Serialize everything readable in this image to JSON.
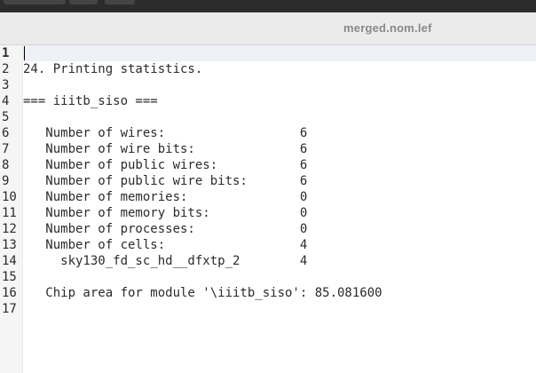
{
  "tab": {
    "title": "merged.nom.lef"
  },
  "editor": {
    "current_line": 1,
    "lines": [
      "",
      "24. Printing statistics.",
      "",
      "=== iiitb_siso ===",
      "",
      "   Number of wires:                  6",
      "   Number of wire bits:              6",
      "   Number of public wires:           6",
      "   Number of public wire bits:       6",
      "   Number of memories:               0",
      "   Number of memory bits:            0",
      "   Number of processes:              0",
      "   Number of cells:                  4",
      "     sky130_fd_sc_hd__dfxtp_2        4",
      "",
      "   Chip area for module '\\iiitb_siso': 85.081600",
      ""
    ],
    "line_numbers": [
      "1",
      "2",
      "3",
      "4",
      "5",
      "6",
      "7",
      "8",
      "9",
      "10",
      "11",
      "12",
      "13",
      "14",
      "15",
      "16",
      "17"
    ]
  }
}
